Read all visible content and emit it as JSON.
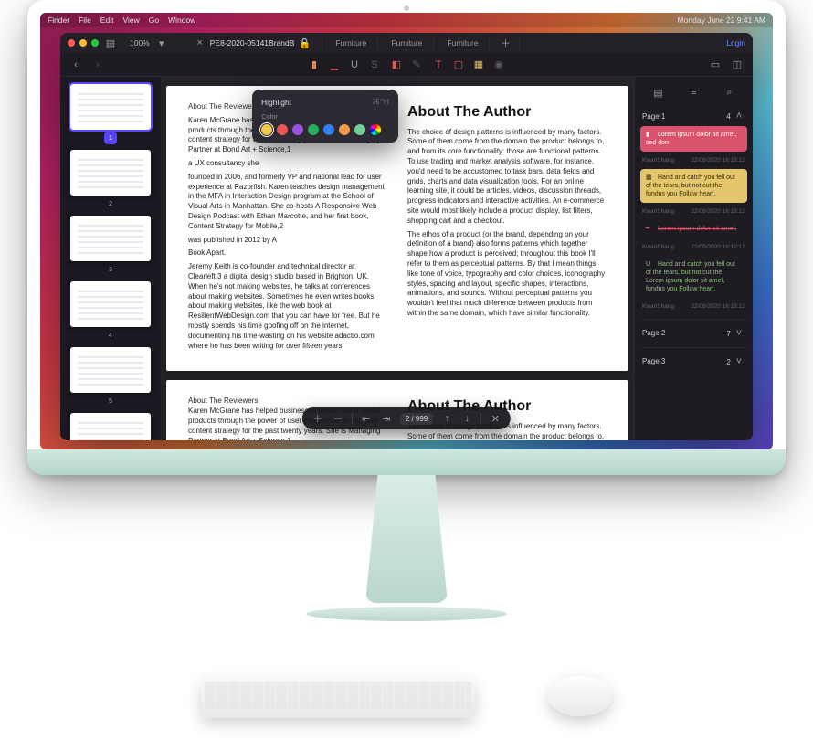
{
  "menubar": {
    "items": [
      "Finder",
      "File",
      "Edit",
      "View",
      "Go",
      "Window"
    ],
    "datetime": "Monday June 22  9:41 AM"
  },
  "window": {
    "zoom": "100%",
    "tabs": [
      {
        "label": "PE8-2020-05141BrandB",
        "locked": true,
        "active": true
      },
      {
        "label": "Furniture"
      },
      {
        "label": "Furniture"
      },
      {
        "label": "Furniture"
      }
    ],
    "login": "Login"
  },
  "popover": {
    "title": "Highlight",
    "shortcut": "⌘^H",
    "color_label": "Color",
    "swatches": [
      "#f2c94c",
      "#eb5757",
      "#9b51e0",
      "#27ae60",
      "#2f80ed",
      "#f2994a",
      "#6fcf97",
      "#ff2e9a"
    ]
  },
  "thumbnails": {
    "count": 6,
    "selected": 1
  },
  "doc": {
    "left_head": "About The Reviewers",
    "right_head": "About The Author",
    "left_p1": "Karen McGrane has helped businesses create better digital products through the power of user experience design and content strategy for the past twenty years. She is Managing Partner at Bond Art + Science,1",
    "left_p2": "a UX consultancy she",
    "left_p3": "founded in 2006, and formerly VP and national lead for user experience at Razorfish. Karen teaches design management in the MFA in Interaction Design program at the School of Visual Arts in Manhattan. She co-hosts A Responsive Web Design Podcast with Ethan Marcotte, and her first book, Content Strategy for Mobile,2",
    "left_p4": "was published in 2012 by A",
    "left_p5": "Book Apart.",
    "left_p6": "Jeremy Keith is co-founder and technical director at Clearleft,3 a digital design studio based in Brighton, UK. When he's not making websites, he talks at conferences about making websites. Sometimes he even writes books about making websites, like the web book at ResilientWebDesign.com that you can have for free. But he mostly spends his time goofing off on the internet, documenting his time-wasting on his website adactio.com where he has been writing for over fifteen years.",
    "right_p1": "The choice of design patterns is influenced by many factors. Some of them come from the domain the product belongs to, and from its core functionality: those are functional patterns. To use trading and market analysis software, for instance, you'd need to be accustomed to task bars, data fields and grids, charts and data visualization tools. For an online learning site, it could be articles, videos, discussion threads, progress indicators and interactive activities. An e-commerce site would most likely include a product display, list filters, shopping cart and a checkout.",
    "right_p2": "The ethos of a product (or the brand, depending on your definition of a brand) also forms patterns which together shape how a product is perceived; throughout this book I'll refer to them as perceptual patterns. By that I mean things like tone of voice, typography and color choices, iconography styles, spacing and layout, specific shapes, interactions, animations, and sounds. Without perceptual patterns you wouldn't feel that much difference between products from within the same domain, which have similar functionality.",
    "page2_left": "About The Reviewers\nKaren McGrane has helped businesses create better digital products through the power of user experience design and content strategy for the past twenty years. She is Managing Partner at Bond Art + Science,1",
    "page2_right": "The choice of design patterns is influenced by many factors. Some of them come from the domain the product belongs to,"
  },
  "bottombar": {
    "page_indicator": "2 / 999"
  },
  "sidepanel": {
    "page1": {
      "label": "Page 1",
      "count": "4"
    },
    "page2": {
      "label": "Page 2",
      "count": "7"
    },
    "page3": {
      "label": "Page 3",
      "count": "2"
    },
    "user": "KwanShang",
    "timestamp": "22/09/2020 16:12:12",
    "notes": [
      {
        "type": "pink",
        "text": "Lorem ipsum dolor sit amet, sed don"
      },
      {
        "type": "yellow",
        "text": "Hand and catch you fell out of the tears, but not cut the fundus you Follow heart."
      },
      {
        "type": "strike",
        "text": "Lorem ipsum dolor sit amet,"
      },
      {
        "type": "under",
        "text": "Hand and catch you fell out of the tears, but not cut the Lorem ipsum dolor sit amet, fundus you Follow heart."
      }
    ]
  }
}
